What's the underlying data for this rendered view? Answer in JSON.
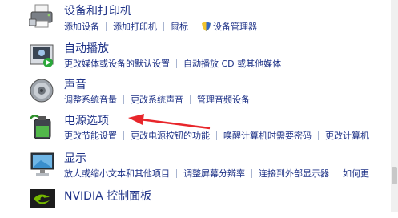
{
  "categories": [
    {
      "title": "设备和打印机",
      "icon": "printer-icon",
      "links": [
        "添加设备",
        "添加打印机",
        "鼠标",
        "设备管理器"
      ]
    },
    {
      "title": "自动播放",
      "icon": "autoplay-icon",
      "links": [
        "更改媒体或设备的默认设置",
        "自动播放 CD 或其他媒体"
      ]
    },
    {
      "title": "声音",
      "icon": "speaker-icon",
      "links": [
        "调整系统音量",
        "更改系统声音",
        "管理音频设备"
      ]
    },
    {
      "title": "电源选项",
      "icon": "battery-icon",
      "links": [
        "更改节能设置",
        "更改电源按钮的功能",
        "唤醒计算机时需要密码",
        "更改计算机"
      ]
    },
    {
      "title": "显示",
      "icon": "monitor-icon",
      "links": [
        "放大或缩小文本和其他项目",
        "调整屏幕分辨率",
        "连接到外部显示器",
        "如何更"
      ]
    },
    {
      "title": "NVIDIA 控制面板",
      "icon": "nvidia-icon",
      "links": []
    }
  ],
  "colors": {
    "link": "#1e3287",
    "arrow": "#e8262b"
  }
}
